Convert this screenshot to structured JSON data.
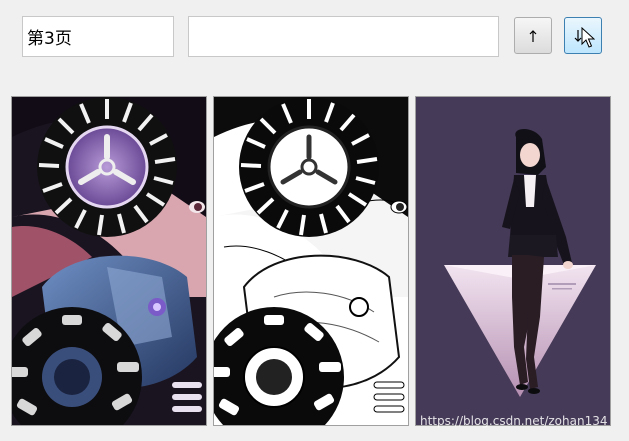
{
  "toolbar": {
    "page_indicator": "第3页",
    "search_value": "",
    "prev_button_icon": "arrow-up-icon",
    "next_button_icon": "arrow-down-icon"
  },
  "images": [
    {
      "name": "original-image",
      "description_icon": "gas-mask-illustration-color"
    },
    {
      "name": "processed-image",
      "description_icon": "gas-mask-illustration-grayscale"
    },
    {
      "name": "third-image",
      "description_icon": "anime-girl-illustration"
    }
  ],
  "watermark": "https://blog.csdn.net/zohan134",
  "colors": {
    "window_bg": "#f0f0f0",
    "active_button_border": "#3c7fb1",
    "active_button_bg": "#bee6fd",
    "panel3_bg": "#453a57"
  }
}
